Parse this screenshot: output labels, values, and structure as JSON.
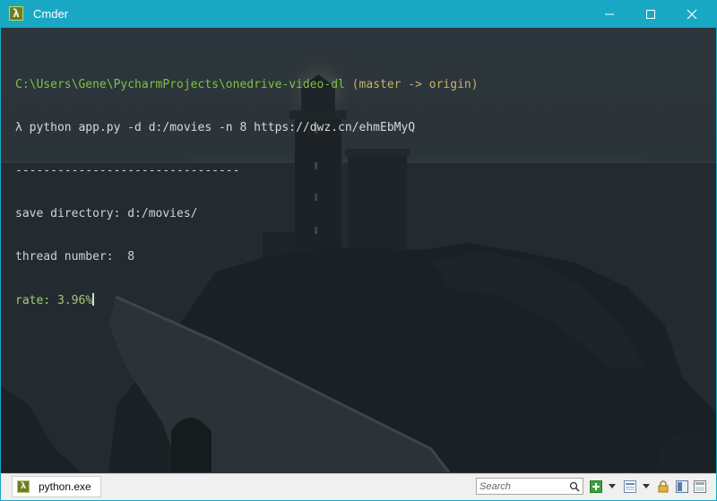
{
  "window": {
    "title": "Cmder"
  },
  "terminal": {
    "cwd": "C:\\Users\\Gene\\PycharmProjects\\onedrive-video-dl",
    "branch": " (master -> origin)",
    "prompt": "λ",
    "command": " python app.py -d d:/movies -n 8 https://dwz.cn/ehmEbMyQ",
    "separator": "--------------------------------",
    "save_directory": "save directory: d:/movies/",
    "thread_number": "thread number:  8",
    "rate": "rate: 3.96%"
  },
  "statusbar": {
    "tab_label": "python.exe",
    "search_placeholder": "Search"
  },
  "colors": {
    "titlebar": "#19a8c4",
    "path": "#7fc142",
    "branch": "#c7b26a"
  }
}
